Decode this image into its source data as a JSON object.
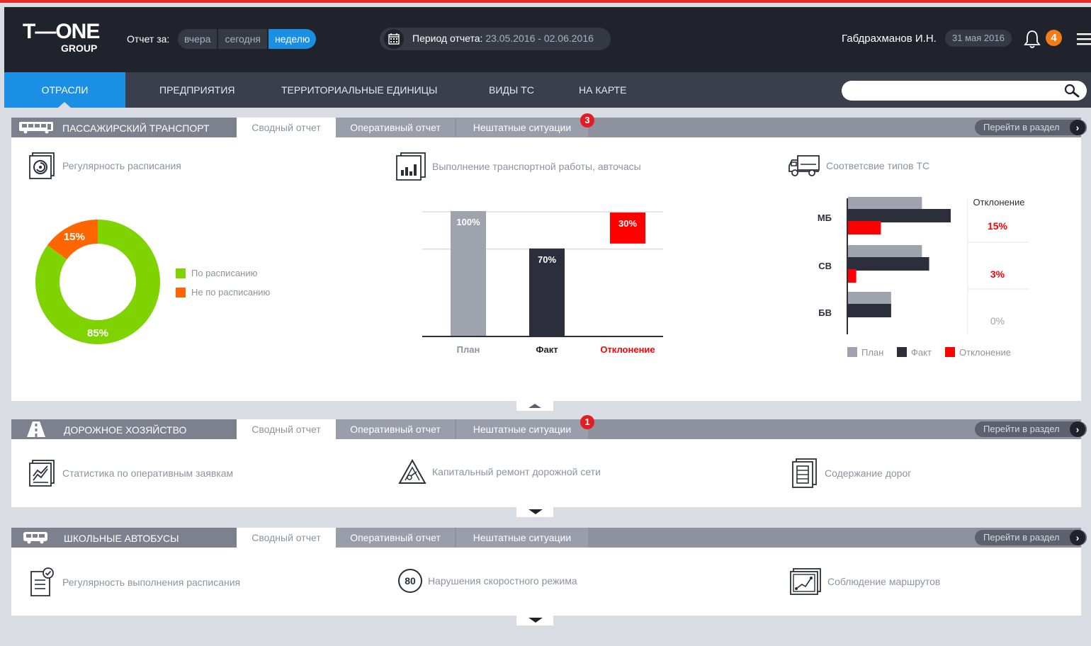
{
  "header": {
    "logo": {
      "main": "T—ONE",
      "sub": "GROUP"
    },
    "report_label": "Отчет за:",
    "periods": [
      {
        "label": "вчера",
        "active": false
      },
      {
        "label": "сегодня",
        "active": false
      },
      {
        "label": "неделю",
        "active": true
      }
    ],
    "period_label": "Период отчета:",
    "period_value": "23.05.2016 - 02.06.2016",
    "user": "Габдрахманов И.Н.",
    "date": "31 мая 2016",
    "notifications": "4",
    "icons": {
      "calendar": "calendar-icon",
      "bell": "bell-icon",
      "menu": "hamburger-menu-icon",
      "search": "search-icon"
    }
  },
  "nav": {
    "items": [
      "ОТРАСЛИ",
      "ПРЕДПРИЯТИЯ",
      "ТЕРРИТОРИАЛЬНЫЕ ЕДИНИЦЫ",
      "ВИДЫ ТС",
      "НА КАРТЕ"
    ],
    "active_index": 0,
    "search_placeholder": ""
  },
  "colors": {
    "accent": "#1a8fe3",
    "topbar": "#20232b",
    "green": "#7ed300",
    "orange": "#ff6600",
    "red": "#ff0000",
    "plan_gray": "#9fa3ae",
    "fact_dark": "#2c2f3b",
    "badge_orange": "#f07d1a"
  },
  "sections": [
    {
      "title": "ПАССАЖИРСКИЙ ТРАНСПОРТ",
      "icon": "bus-icon",
      "tabs": [
        "Сводный отчет",
        "Оперативный отчет",
        "Нештатные ситуации"
      ],
      "active_tab": 0,
      "badge": "3",
      "goto": "Перейти в раздел",
      "cards": [
        {
          "label": "Регулярность расписания",
          "icon": "schedule-regularity-icon"
        },
        {
          "label": "Выполнение транспортной работы, авточасы",
          "icon": "bar-chart-doc-icon"
        },
        {
          "label": "Соответсвие типов ТС",
          "icon": "truck-icon"
        }
      ]
    },
    {
      "title": "ДОРОЖНОЕ ХОЗЯЙСТВО",
      "icon": "road-icon",
      "tabs": [
        "Сводный отчет",
        "Оперативный отчет",
        "Нештатные ситуации"
      ],
      "active_tab": 0,
      "badge": "1",
      "goto": "Перейти в раздел",
      "cards": [
        {
          "label": "Статистика по оперативным заявкам",
          "icon": "stats-chart-icon"
        },
        {
          "label": "Капитальный ремонт дорожной сети",
          "icon": "road-warning-icon"
        },
        {
          "label": "Содержание дорог",
          "icon": "document-list-icon"
        }
      ]
    },
    {
      "title": "ШКОЛЬНЫЕ АВТОБУСЫ",
      "icon": "school-bus-icon",
      "tabs": [
        "Сводный отчет",
        "Оперативный отчет",
        "Нештатные ситуации"
      ],
      "active_tab": 0,
      "badge": "",
      "goto": "Перейти в раздел",
      "cards": [
        {
          "label": "Регулярность выполнения расписания",
          "icon": "checklist-icon"
        },
        {
          "label": "Нарушения скоростного режима",
          "icon": "speed-limit-icon",
          "icon_text": "80"
        },
        {
          "label": "Соблюдение маршрутов",
          "icon": "route-map-icon"
        }
      ]
    }
  ],
  "chart_data": [
    {
      "type": "pie",
      "title": "Регулярность расписания",
      "slices": [
        {
          "label": "По расписанию",
          "value": 85,
          "display": "85%",
          "color": "#7ed300"
        },
        {
          "label": "Не по расписанию",
          "value": 15,
          "display": "15%",
          "color": "#ff6600"
        }
      ]
    },
    {
      "type": "bar",
      "title": "Выполнение транспортной работы, авточасы",
      "categories": [
        "План",
        "Факт",
        "Отклонение"
      ],
      "values": [
        100,
        70,
        30
      ],
      "labels": [
        "100%",
        "70%",
        "30%"
      ],
      "colors": [
        "#9fa3ae",
        "#2c2f3b",
        "#ff0000"
      ],
      "ylim": [
        0,
        100
      ]
    },
    {
      "type": "bar",
      "orientation": "horizontal",
      "title": "Соответсвие типов ТС",
      "categories": [
        "МБ",
        "СВ",
        "БВ"
      ],
      "series": [
        {
          "name": "План",
          "values": [
            72,
            72,
            42
          ],
          "color": "#9fa3ae"
        },
        {
          "name": "Факт",
          "values": [
            100,
            79,
            42
          ],
          "color": "#2c2f3b"
        },
        {
          "name": "Отклонение",
          "values": [
            32,
            8,
            0
          ],
          "color": "#ff0000"
        }
      ],
      "deviation_header": "Отклонение",
      "deviation": [
        "15%",
        "3%",
        "0%"
      ]
    }
  ]
}
